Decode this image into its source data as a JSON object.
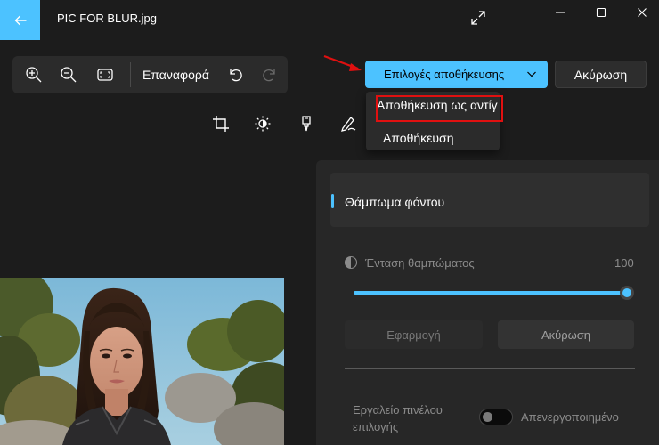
{
  "window": {
    "title": "PIC FOR BLUR.jpg",
    "back_icon": "arrow-left-icon",
    "fullscreen_icon": "expand-icon",
    "controls": [
      "minimize-icon",
      "maximize-icon",
      "close-icon"
    ]
  },
  "toolbar": {
    "icons": [
      "zoom-in-icon",
      "zoom-out-icon",
      "fit-screen-icon"
    ],
    "reset_label": "Επαναφορά",
    "undo_icon": "undo-icon",
    "redo_icon": "redo-icon"
  },
  "save": {
    "options_label": "Επιλογές αποθήκευσης",
    "cancel_label": "Ακύρωση",
    "dropdown": [
      {
        "label": "Αποθήκευση ως αντίγραφο",
        "highlighted": true
      },
      {
        "label": "Αποθήκευση",
        "highlighted": false
      }
    ]
  },
  "edit_tools": [
    "crop-icon",
    "adjust-brightness-icon",
    "filter-icon",
    "markup-pen-icon"
  ],
  "panel": {
    "section_title": "Θάμπωμα φόντου",
    "intensity_label": "Ένταση θαμπώματος",
    "intensity_value": "100",
    "intensity_fraction": 1.0,
    "apply_label": "Εφαρμογή",
    "cancel_label": "Ακύρωση",
    "brush_tool_label": "Εργαλείο πινέλου επιλογής",
    "toggle_label": "Απενεργοποιημένο",
    "toggle_on": false
  },
  "colors": {
    "accent": "#4cc2ff",
    "background": "#1c1c1c",
    "panel": "#272727",
    "annotation_red": "#e01010"
  }
}
